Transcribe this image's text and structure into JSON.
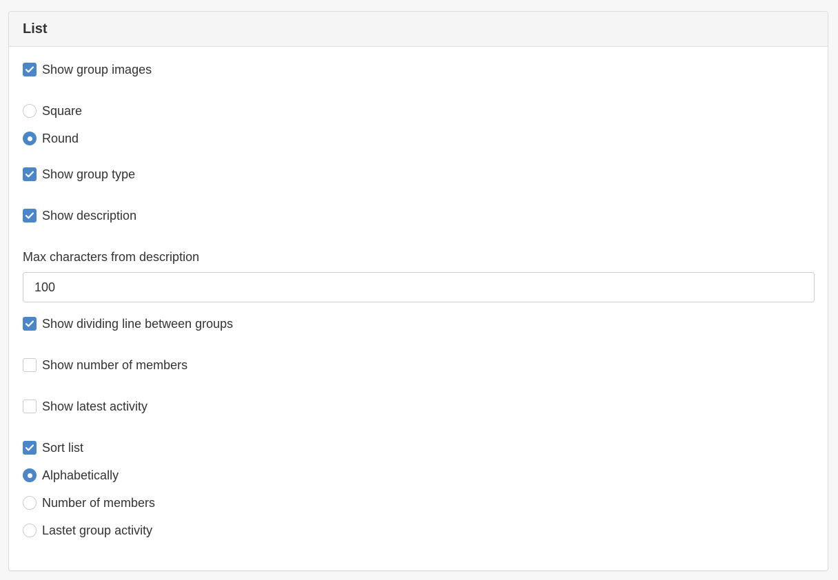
{
  "panel": {
    "title": "List"
  },
  "options": {
    "show_group_images": {
      "label": "Show group images",
      "checked": true
    },
    "image_shape": {
      "square": {
        "label": "Square",
        "selected": false
      },
      "round": {
        "label": "Round",
        "selected": true
      }
    },
    "show_group_type": {
      "label": "Show group type",
      "checked": true
    },
    "show_description": {
      "label": "Show description",
      "checked": true
    },
    "max_chars": {
      "label": "Max characters from description",
      "value": "100"
    },
    "show_dividing_line": {
      "label": "Show dividing line between groups",
      "checked": true
    },
    "show_number_of_members": {
      "label": "Show number of members",
      "checked": false
    },
    "show_latest_activity": {
      "label": "Show latest activity",
      "checked": false
    },
    "sort_list": {
      "label": "Sort list",
      "checked": true
    },
    "sort_by": {
      "alphabetically": {
        "label": "Alphabetically",
        "selected": true
      },
      "number_of_members": {
        "label": "Number of members",
        "selected": false
      },
      "latest_activity": {
        "label": "Lastet group activity",
        "selected": false
      }
    }
  },
  "colors": {
    "accent": "#4a86c8",
    "border": "#dddddd",
    "heading_bg": "#f5f5f5",
    "text": "#333333"
  }
}
